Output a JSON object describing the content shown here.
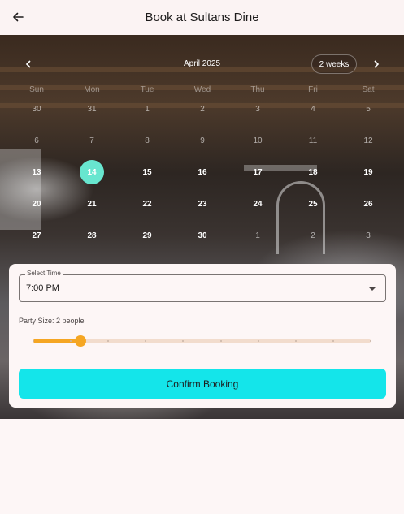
{
  "appbar": {
    "title": "Book at Sultans Dine",
    "back_icon": "arrow-left-icon"
  },
  "calendar": {
    "month": "April 2025",
    "format_button": "2 weeks",
    "prev_icon": "chevron-left-icon",
    "next_icon": "chevron-right-icon",
    "weekdays": [
      "Sun",
      "Mon",
      "Tue",
      "Wed",
      "Thu",
      "Fri",
      "Sat"
    ],
    "weeks": [
      [
        "30",
        "31",
        "1",
        "2",
        "3",
        "4",
        "5"
      ],
      [
        "6",
        "7",
        "8",
        "9",
        "10",
        "11",
        "12"
      ],
      [
        "13",
        "14",
        "15",
        "16",
        "17",
        "18",
        "19"
      ],
      [
        "20",
        "21",
        "22",
        "23",
        "24",
        "25",
        "26"
      ],
      [
        "27",
        "28",
        "29",
        "30",
        "1",
        "2",
        "3"
      ]
    ],
    "selected_day": "14",
    "selected_color": "#68e6cf"
  },
  "booking": {
    "time_label": "Select Time",
    "time_value": "7:00 PM",
    "party_label": "Party Size: 2 people",
    "party_size": 2,
    "party_min": 1,
    "party_max": 10,
    "confirm_label": "Confirm Booking",
    "confirm_color": "#14e5ea",
    "slider_color": "#f5a623"
  }
}
